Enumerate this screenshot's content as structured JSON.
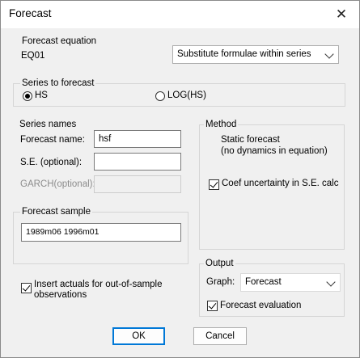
{
  "window": {
    "title": "Forecast"
  },
  "equation": {
    "group_label": "Forecast equation",
    "name": "EQ01",
    "method_option": "Substitute formulae within series"
  },
  "series_to_forecast": {
    "group_label": "Series to forecast",
    "option1": "HS",
    "option2": "LOG(HS)",
    "selected": "HS"
  },
  "series_names": {
    "group_label": "Series names",
    "forecast_label": "Forecast name:",
    "forecast_value": "hsf",
    "se_label": "S.E. (optional):",
    "se_value": "",
    "garch_label": "GARCH(optional):",
    "garch_value": ""
  },
  "method": {
    "group_label": "Method",
    "description_line1": "Static forecast",
    "description_line2": "(no dynamics in equation)",
    "coef_uncertainty_label": "Coef uncertainty in S.E. calc",
    "coef_uncertainty_checked": true
  },
  "sample": {
    "group_label": "Forecast sample",
    "value": "1989m06 1996m01"
  },
  "insert_actuals": {
    "label_line1": "Insert actuals for out-of-sample",
    "label_line2": "observations",
    "checked": true
  },
  "output": {
    "group_label": "Output",
    "graph_label": "Graph:",
    "graph_value": "Forecast",
    "evaluation_label": "Forecast evaluation",
    "evaluation_checked": true
  },
  "buttons": {
    "ok": "OK",
    "cancel": "Cancel"
  },
  "icons": {
    "close": "close-icon",
    "dropdown": "chevron-down-icon"
  }
}
